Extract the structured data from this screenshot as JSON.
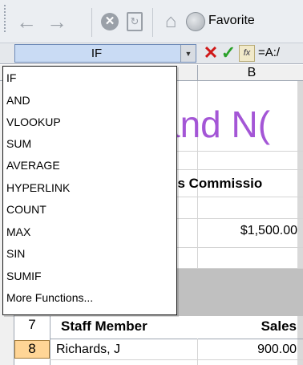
{
  "toolbar": {
    "back_icon": "arrow-left-icon",
    "forward_icon": "arrow-right-icon",
    "stop_icon": "stop-icon",
    "refresh_icon": "refresh-icon",
    "home_icon": "home-icon",
    "favorites_icon": "favorites-icon",
    "favorites_label": "Favorite"
  },
  "formula_bar": {
    "name_box_value": "IF",
    "cancel_glyph": "✕",
    "enter_glyph": "✓",
    "fx_label": "fx",
    "formula_text": "=A:/"
  },
  "sheet": {
    "column_b": "B",
    "title_fragment": "and N(",
    "header_fragment": "es Commissio",
    "money_value": "$1,500.00",
    "row7": {
      "num": "7",
      "staff_label": "Staff Member",
      "sales_label": "Sales"
    },
    "row8": {
      "num": "8",
      "name": "Richards, J",
      "amount": "900.00"
    }
  },
  "dropdown": {
    "items": [
      "IF",
      "AND",
      "VLOOKUP",
      "SUM",
      "AVERAGE",
      "HYPERLINK",
      "COUNT",
      "MAX",
      "SIN",
      "SUMIF",
      "More Functions..."
    ]
  },
  "colors": {
    "title_purple": "#a456d6",
    "namebox_blue": "#c9dbf4",
    "selected_row_header": "#ffd596",
    "cancel_red": "#d01818",
    "enter_green": "#2aa12a"
  }
}
